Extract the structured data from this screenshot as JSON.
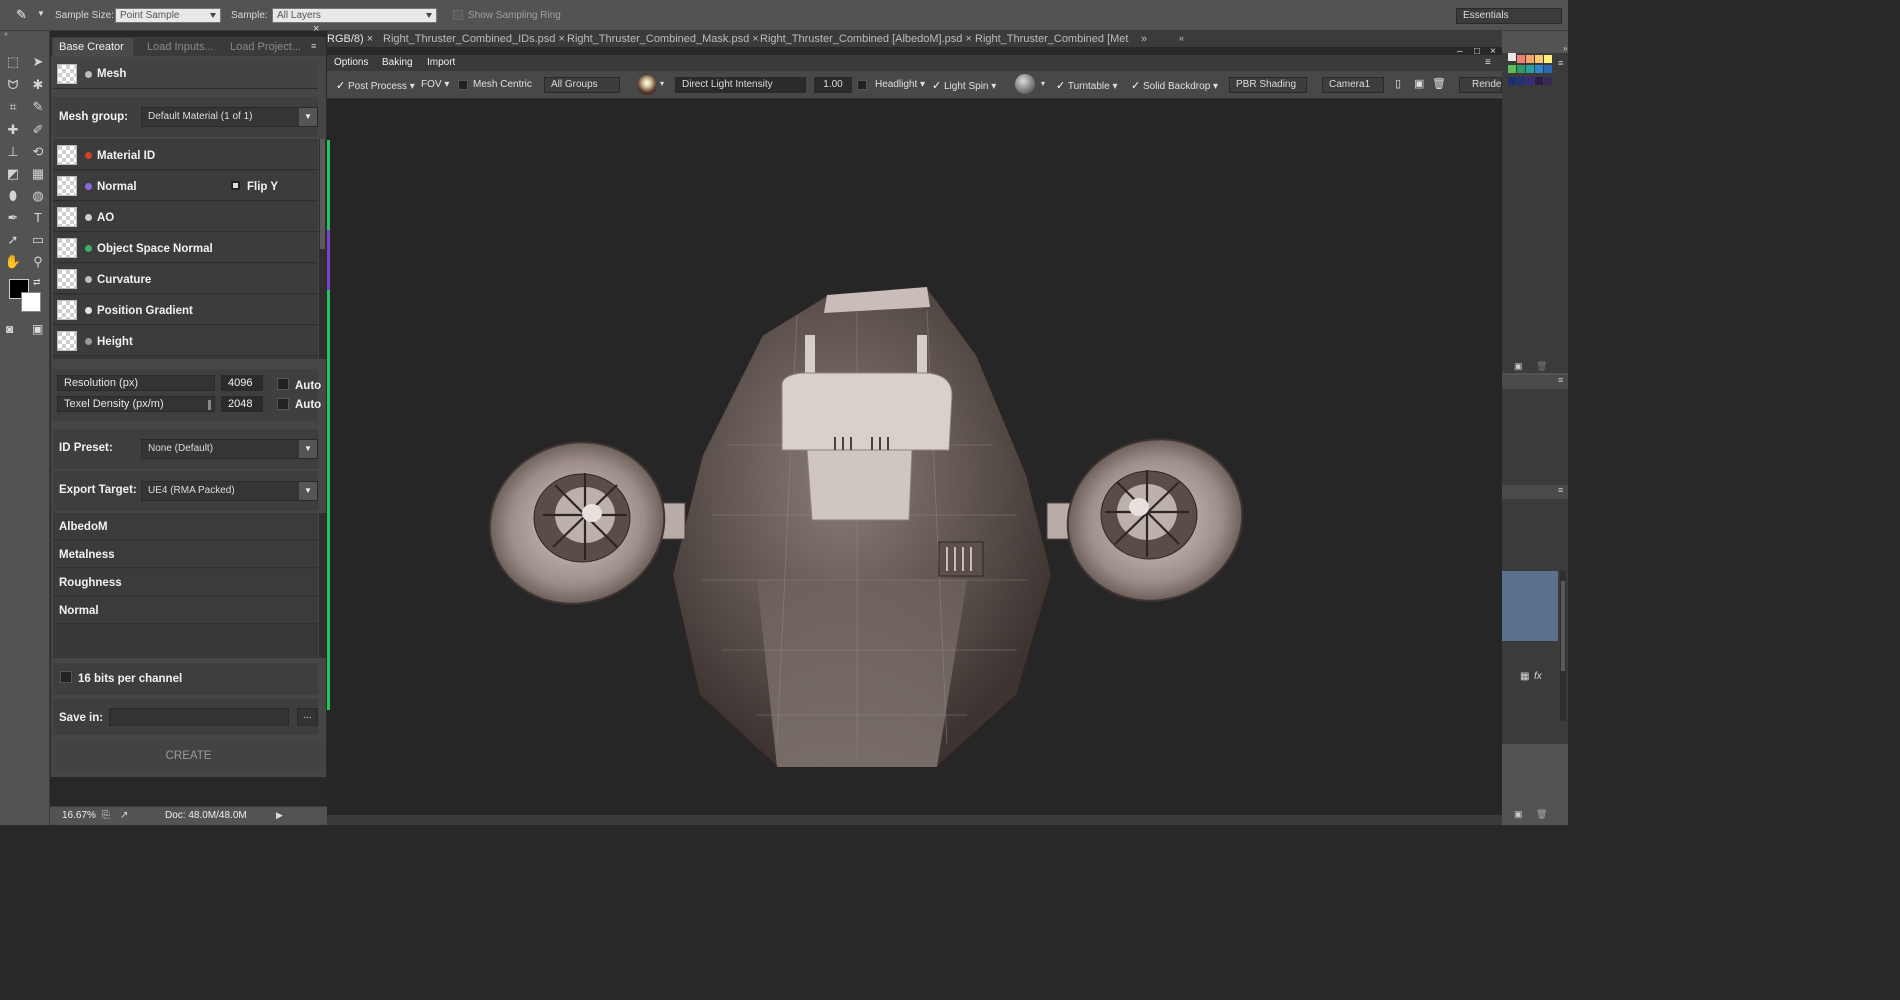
{
  "options_bar": {
    "sample_size_label": "Sample Size:",
    "sample_size_value": "Point Sample",
    "sample_label": "Sample:",
    "sample_value": "All Layers",
    "show_sampling_ring": "Show Sampling Ring",
    "workspace": "Essentials"
  },
  "doc_tabs": [
    "RGB/8)",
    "Right_Thruster_Combined_IDs.psd",
    "Right_Thruster_Combined_Mask.psd",
    "Right_Thruster_Combined [AlbedoM].psd",
    "Right_Thruster_Combined [Met"
  ],
  "panel": {
    "tabs": [
      "Base Creator",
      "Load Inputs...",
      "Load Project..."
    ],
    "mesh_label": "Mesh",
    "mesh_group_label": "Mesh group:",
    "mesh_group_value": "Default Material (1 of 1)",
    "maps": [
      {
        "label": "Material ID",
        "dot": "#d0402a"
      },
      {
        "label": "Normal",
        "dot": "#8a6ad8"
      },
      {
        "label": "AO",
        "dot": "#cfcfcf"
      },
      {
        "label": "Object Space Normal",
        "dot": "#3fae6a"
      },
      {
        "label": "Curvature",
        "dot": "#bdbdbd"
      },
      {
        "label": "Position Gradient",
        "dot": "#e4e4e4"
      },
      {
        "label": "Height",
        "dot": "#9a9a9a"
      }
    ],
    "flip_y": "Flip Y",
    "resolution_label": "Resolution (px)",
    "resolution_value": "4096",
    "texel_label": "Texel Density (px/m)",
    "texel_value": "2048",
    "auto": "Auto",
    "id_preset_label": "ID Preset:",
    "id_preset_value": "None (Default)",
    "export_target_label": "Export Target:",
    "export_target_value": "UE4 (RMA Packed)",
    "outputs": [
      "AlbedoM",
      "Metalness",
      "Roughness",
      "Normal"
    ],
    "bits_label": "16 bits per channel",
    "save_in_label": "Save in:",
    "browse": "...",
    "create": "CREATE"
  },
  "viewer": {
    "tabs": [
      "Options",
      "Baking",
      "Import"
    ],
    "post_process": "Post Process",
    "fov": "FOV",
    "mesh_centric": "Mesh Centric",
    "groups": "All Groups",
    "light_field": "Direct Light Intensity",
    "light_value": "1.00",
    "headlight": "Headlight",
    "light_spin": "Light Spin",
    "turntable": "Turntable",
    "solid_backdrop": "Solid Backdrop",
    "shading": "PBR Shading",
    "camera": "Camera1",
    "render": "Render"
  },
  "status": {
    "zoom": "16.67%",
    "doc": "Doc: 48.0M/48.0M"
  },
  "colors": {
    "accent_green": "#1ec85a",
    "layer_highlight": "#5b6f8e"
  }
}
